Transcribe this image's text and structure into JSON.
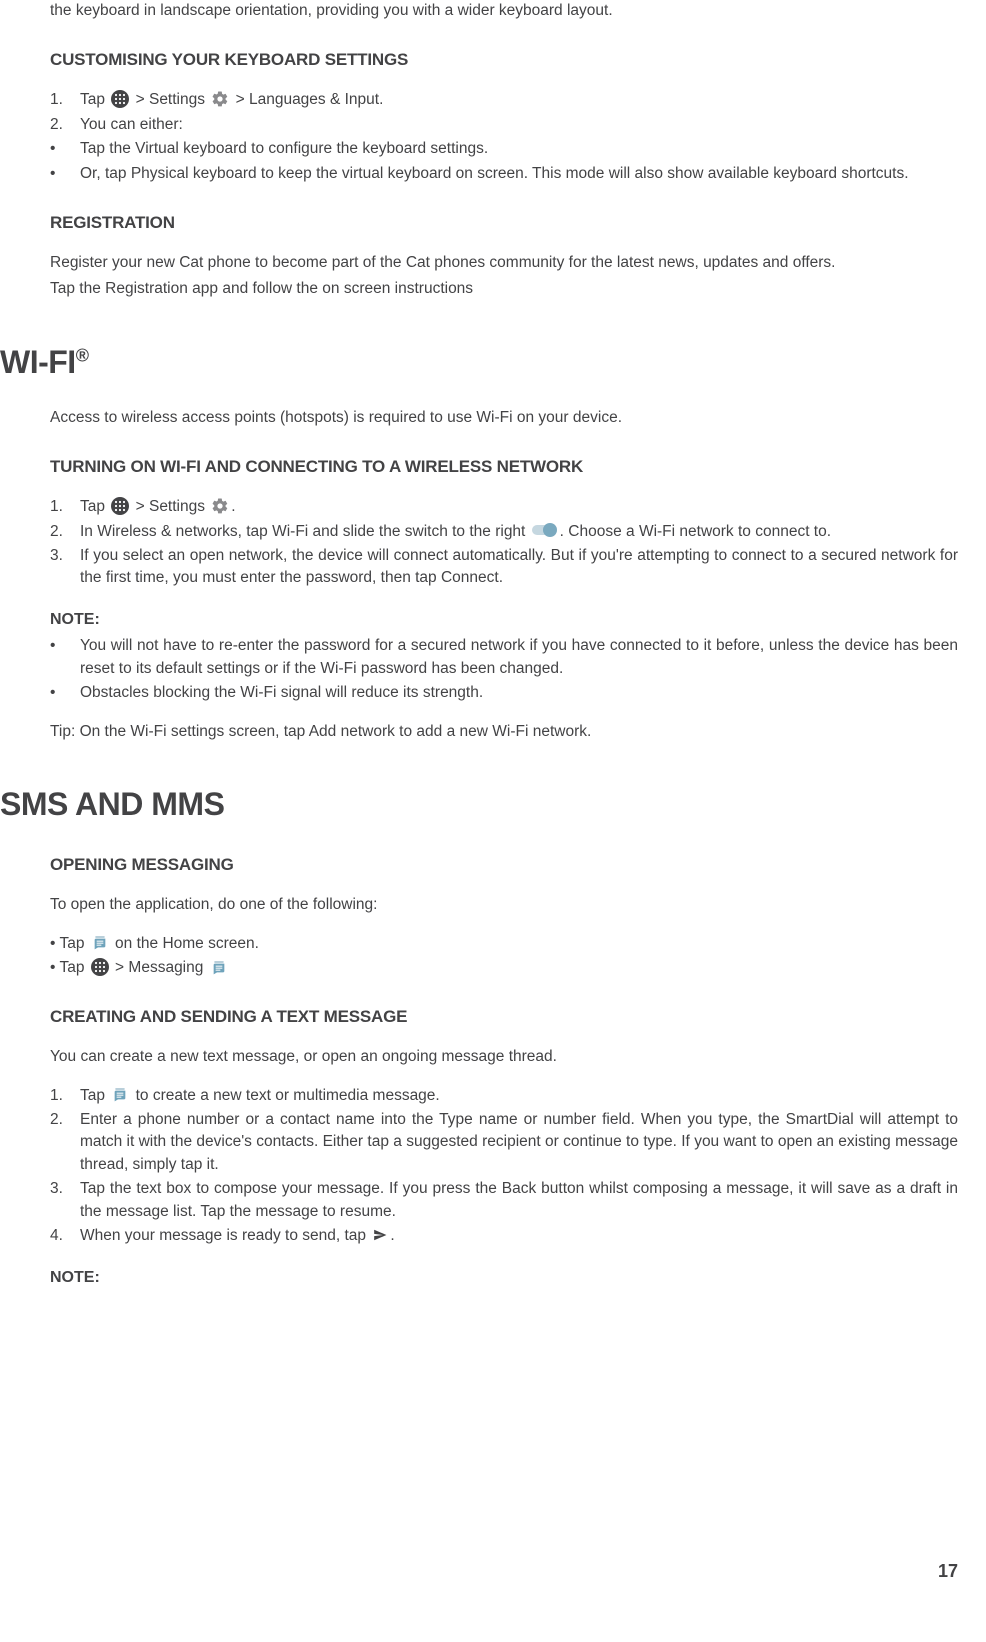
{
  "page_number": "17",
  "top_paragraph": "the keyboard in landscape orientation, providing you with a wider keyboard layout.",
  "sec_customising": {
    "heading": "CUSTOMISING YOUR KEYBOARD SETTINGS",
    "items": [
      {
        "marker": "1.",
        "pre": "Tap ",
        "mid1": " > Settings ",
        "post": " > Languages & Input."
      },
      {
        "marker": "2.",
        "text": "You can either:"
      },
      {
        "marker": "•",
        "text": "Tap the Virtual keyboard to configure the keyboard settings."
      },
      {
        "marker": "•",
        "text": "Or, tap Physical keyboard to keep the virtual keyboard on screen. This mode will also show available keyboard shortcuts."
      }
    ]
  },
  "sec_registration": {
    "heading": "REGISTRATION",
    "p1": "Register your new Cat phone to become part of the Cat phones community for the latest news, updates and offers.",
    "p2": "Tap the Registration app and follow the on screen instructions"
  },
  "sec_wifi": {
    "heading": "WI-FI",
    "sup": "®",
    "intro": "Access to wireless access points (hotspots) is required to use Wi-Fi on your device.",
    "sub_heading": "TURNING ON WI-FI AND CONNECTING TO A WIRELESS NETWORK",
    "steps": [
      {
        "marker": "1.",
        "pre": "Tap  ",
        "mid": " > Settings ",
        "post": "."
      },
      {
        "marker": "2.",
        "pre": "In Wireless & networks, tap Wi-Fi and slide the switch to the right ",
        "post": ". Choose a Wi-Fi network to connect to."
      },
      {
        "marker": "3.",
        "text": "If you select an open network, the device will connect automatically. But if you're attempting to connect to a secured network for the first time, you must enter the password, then tap Connect."
      }
    ],
    "note_heading": "NOTE:",
    "notes": [
      {
        "marker": "•",
        "text": "You will not have to re-enter the password for a secured network if you have connected to it before, unless the device has been reset to its default settings or if the Wi-Fi password has been changed."
      },
      {
        "marker": "•",
        "text": "Obstacles blocking the Wi-Fi signal will reduce its strength."
      }
    ],
    "tip": "Tip: On the Wi-Fi settings screen, tap Add network to add a new Wi-Fi network."
  },
  "sec_sms": {
    "heading": "SMS AND MMS",
    "open_heading": "OPENING MESSAGING",
    "open_intro": "To open the application, do one of the following:",
    "open_bullets": [
      {
        "pre": "• Tap ",
        "post": " on the Home screen."
      },
      {
        "pre": "• Tap ",
        "mid": " > Messaging "
      }
    ],
    "create_heading": "CREATING AND SENDING A TEXT MESSAGE",
    "create_intro": "You can create a new text message, or open an ongoing message thread.",
    "create_steps": [
      {
        "marker": "1.",
        "pre": "Tap ",
        "post": " to create a new text or multimedia message."
      },
      {
        "marker": "2.",
        "text": "Enter a phone number or a contact name into the Type name or number field. When you type, the SmartDial will attempt to match it with the device's contacts. Either tap a suggested recipient or continue to type. If you want to open an existing message thread, simply tap it."
      },
      {
        "marker": "3.",
        "text": "Tap the text box to compose your message. If you press the Back button whilst composing a message, it will save as a draft in the message list. Tap the message to resume."
      },
      {
        "marker": "4.",
        "pre": "When your message is ready to send, tap ",
        "post": "."
      }
    ],
    "note_heading": "NOTE:"
  }
}
